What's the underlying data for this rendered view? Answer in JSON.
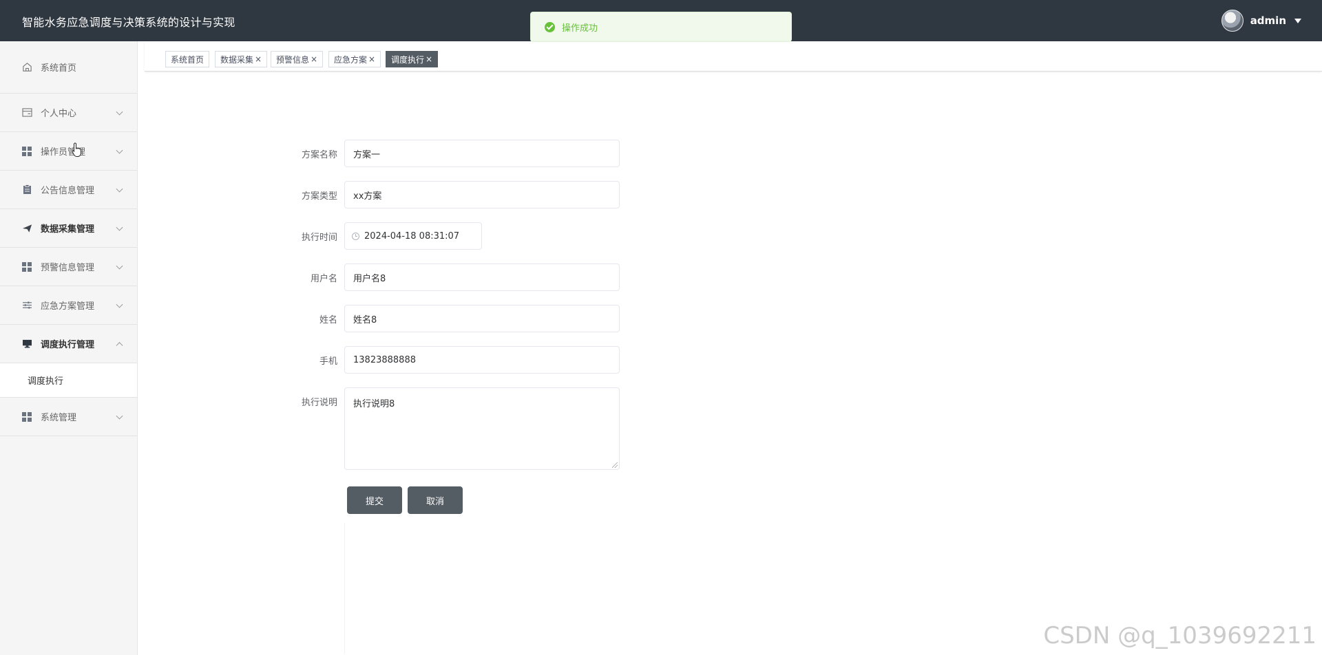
{
  "header": {
    "title": "智能水务应急调度与决策系统的设计与实现",
    "username": "admin"
  },
  "toast": {
    "message": "操作成功"
  },
  "sidebar": {
    "items": [
      {
        "label": "系统首页",
        "icon": "home-icon"
      },
      {
        "label": "个人中心",
        "icon": "card-icon"
      },
      {
        "label": "操作员管理",
        "icon": "grid-icon"
      },
      {
        "label": "公告信息管理",
        "icon": "clipboard-icon"
      },
      {
        "label": "数据采集管理",
        "icon": "paper-plane-icon"
      },
      {
        "label": "预警信息管理",
        "icon": "grid-icon"
      },
      {
        "label": "应急方案管理",
        "icon": "sliders-icon"
      },
      {
        "label": "调度执行管理",
        "icon": "monitor-icon"
      },
      {
        "label": "系统管理",
        "icon": "grid-icon"
      }
    ],
    "submenu": {
      "label": "调度执行"
    }
  },
  "tabs": [
    {
      "label": "系统首页",
      "closable": false
    },
    {
      "label": "数据采集",
      "closable": true
    },
    {
      "label": "预警信息",
      "closable": true
    },
    {
      "label": "应急方案",
      "closable": true
    },
    {
      "label": "调度执行",
      "closable": true,
      "active": true
    }
  ],
  "tab_close_symbol": "×",
  "form": {
    "plan_name": {
      "label": "方案名称",
      "value": "方案一"
    },
    "plan_type": {
      "label": "方案类型",
      "value": "xx方案"
    },
    "exec_time": {
      "label": "执行时间",
      "value": "2024-04-18 08:31:07"
    },
    "username": {
      "label": "用户名",
      "value": "用户名8"
    },
    "name": {
      "label": "姓名",
      "value": "姓名8"
    },
    "phone": {
      "label": "手机",
      "value": "13823888888"
    },
    "description": {
      "label": "执行说明",
      "value": "执行说明8"
    },
    "submit_label": "提交",
    "cancel_label": "取消"
  },
  "watermark": "CSDN @q_1039692211",
  "colors": {
    "header_bg": "#2f3741",
    "sidebar_bg": "#f5f5f5",
    "button_bg": "#545c64",
    "success": "#67c23a"
  }
}
